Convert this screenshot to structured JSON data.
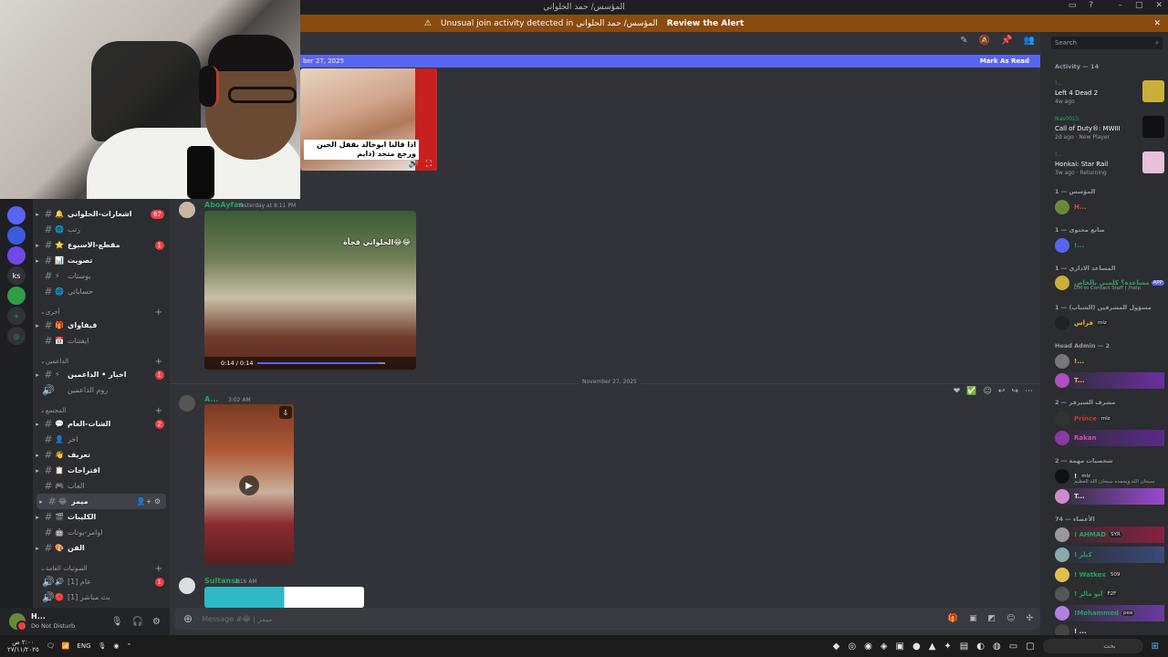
{
  "titlebar": {
    "title": "المؤسس/ حمد الحلواني"
  },
  "alert": {
    "text": "Unusual join activity detected in المؤسس/ حمد الحلواني",
    "button": "Review the Alert"
  },
  "new_messages": {
    "date_fragment": "ber 27, 2025",
    "mark_read": "Mark As Read"
  },
  "channels": [
    {
      "name": "اشعارات-الحلواني",
      "emoji": "🔔",
      "badge": "67",
      "bold": true
    },
    {
      "name": "رتب",
      "emoji": "🌐",
      "badge": "",
      "bold": false
    },
    {
      "name": "مقطع-الاسبوع",
      "emoji": "⭐",
      "badge": "1",
      "bold": true
    },
    {
      "name": "تصويت",
      "emoji": "📊",
      "badge": "",
      "bold": true
    },
    {
      "name": "بوستات",
      "emoji": "⚡",
      "badge": "",
      "bold": false
    },
    {
      "name": "حساباتي",
      "emoji": "🌐",
      "badge": "",
      "bold": false
    },
    {
      "name": "قيفاواي",
      "emoji": "🎁",
      "badge": "",
      "bold": true
    },
    {
      "name": "ايفنتات",
      "emoji": "📅",
      "badge": "",
      "bold": false
    },
    {
      "name": "اخبار • الداعمين",
      "emoji": "⚡",
      "badge": "1",
      "bold": true
    },
    {
      "name": "روم الداعمين",
      "emoji": "🔊",
      "badge": "",
      "bold": false
    },
    {
      "name": "الشات-العام",
      "emoji": "💬",
      "badge": "2",
      "bold": true
    },
    {
      "name": "اخر",
      "emoji": "👤",
      "badge": "",
      "bold": false
    },
    {
      "name": "تعريف",
      "emoji": "👋",
      "badge": "",
      "bold": true
    },
    {
      "name": "اقتراحات",
      "emoji": "📋",
      "badge": "",
      "bold": true
    },
    {
      "name": "العاب",
      "emoji": "🎮",
      "badge": "",
      "bold": false
    },
    {
      "name": "ميمز",
      "emoji": "😂",
      "badge": "",
      "bold": true
    },
    {
      "name": "الكليبات",
      "emoji": "🎬",
      "badge": "",
      "bold": true
    },
    {
      "name": "اوامر-بوتات",
      "emoji": "🤖",
      "badge": "",
      "bold": false
    },
    {
      "name": "الفن",
      "emoji": "🎨",
      "badge": "",
      "bold": true
    },
    {
      "name": "عام [1]",
      "emoji": "🔊",
      "badge": "1",
      "bold": false
    },
    {
      "name": "بث مباشر [1]",
      "emoji": "🔴",
      "badge": "",
      "bold": false
    }
  ],
  "categories": [
    "أخرى",
    "الداعمين",
    "المجتمع",
    "الصوتيات العامة"
  ],
  "user": {
    "name": "H...",
    "status": "Do Not Disturb"
  },
  "messages": [
    {
      "author": "AboAyfan",
      "time": "Yesterday at 8:11 PM",
      "video_caption": "الحلواني فجأة😂😂",
      "duration": "0:14 / 0:14"
    },
    {
      "author": "A...",
      "time": "3:02 AM"
    },
    {
      "author": "Sultansa",
      "time": "3:16 AM"
    }
  ],
  "video1_caption": "اذا قالنا ابوخالد بقفل الجين ورجع متجد (دايم",
  "date_divider": "November 27, 2025",
  "composer": {
    "placeholder": "Message #😂 | ميمز"
  },
  "sidebar": {
    "search": "Search",
    "activity_header": "Activity — 14",
    "activities": [
      {
        "user": "!...",
        "game": "Left 4 Dead 2",
        "meta": "4w ago",
        "color": "#c9b03a"
      },
      {
        "user": "Nas0015",
        "game": "Call of Duty®: MWIII",
        "meta": "2d ago · New Player",
        "color": "#111111"
      },
      {
        "user": "!...",
        "game": "Honkai: Star Rail",
        "meta": "3w ago · Returning",
        "color": "#e8c0d8"
      }
    ],
    "groups": [
      {
        "header": "المؤسس — 1",
        "members": [
          {
            "name": "H...",
            "color": "#f23f43",
            "tag": ""
          }
        ]
      },
      {
        "header": "صانع محتوى — 1",
        "members": [
          {
            "name": "!...",
            "color": "#23a55a",
            "tag": ""
          }
        ]
      },
      {
        "header": "المساعد الاداري — 1",
        "members": [
          {
            "name": "مساعدة؟ كلمني بالخاص",
            "color": "#23a55a",
            "tag": "APP",
            "sub": "DM to Contact Staff | /help"
          }
        ]
      },
      {
        "header": "مسؤول المشرفين (الشباب) — 1",
        "members": [
          {
            "name": "فراس",
            "color": "#f0b232",
            "tag": "mlz"
          }
        ]
      },
      {
        "header": "Head Admin — 2",
        "members": [
          {
            "name": "!...",
            "color": "#f0b232",
            "tag": ""
          },
          {
            "name": "T...",
            "color": "#f0b232",
            "tag": ""
          }
        ]
      },
      {
        "header": "مشرف السيرفر — 2",
        "members": [
          {
            "name": "Prince",
            "color": "#c93434",
            "tag": "mlz"
          },
          {
            "name": "Rakan",
            "color": "#d04db0",
            "tag": ""
          }
        ]
      },
      {
        "header": "شخصيات مهمة — 2",
        "members": [
          {
            "name": "!",
            "color": "#dbdee1",
            "tag": "mlz",
            "sub": "سبحان الله وبحمده سبحان الله العظيم"
          },
          {
            "name": "T...",
            "color": "#dbdee1",
            "tag": ""
          }
        ]
      },
      {
        "header": "الأعضاء — 74",
        "members": [
          {
            "name": "! AHMAD",
            "color": "#23a55a",
            "tag": "SYR"
          },
          {
            "name": "! كيلر",
            "color": "#23a55a",
            "tag": ""
          },
          {
            "name": "! Watkex",
            "color": "#23a55a",
            "tag": "509"
          },
          {
            "name": "! أبو مالز",
            "color": "#23a55a",
            "tag": "F2F"
          },
          {
            "name": "!Mohammed",
            "color": "#23a55a",
            "tag": "pea"
          },
          {
            "name": "! ...",
            "color": "#dbdee1",
            "tag": ""
          }
        ]
      }
    ]
  },
  "taskbar": {
    "time": "٢:٠٠ ص",
    "date": "٢٧/١١/٢٠٢٥",
    "lang": "ENG",
    "search": "بحث"
  }
}
